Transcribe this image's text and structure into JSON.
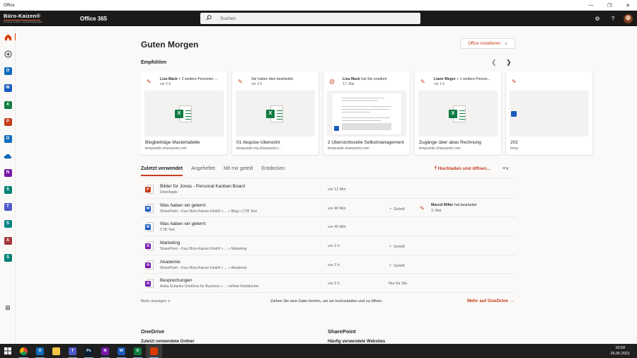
{
  "window": {
    "title": "Office"
  },
  "header": {
    "brand_name": "Büro-Kaizen®",
    "brand_tagline": "Ihr Partner für Büro- und Arbeitsorganisation",
    "app_name": "Office 365",
    "search_placeholder": "Suchen"
  },
  "main": {
    "greeting": "Guten Morgen",
    "install_label": "Office installieren",
    "recommended_title": "Empfohlen",
    "cards": [
      {
        "who": "Lisa Mack",
        "action": " + 2 weitere Personen ...",
        "when": "vor 2 h",
        "name": "Blogbeiträge Mastertabelle",
        "site": "tempuside.sharepoint.com",
        "icon": "pencil-icon",
        "thumb": "excel"
      },
      {
        "who": "",
        "action": "Sie haben dies bearbeitet.",
        "when": "vor 2 h",
        "name": "01 Akquise-Übersicht",
        "site": "tempuside-my.sharepoint.c...",
        "icon": "pencil-icon",
        "thumb": "excel"
      },
      {
        "who": "Lisa Mack",
        "action": " hat Sie erwähnt",
        "when": "17. Mai",
        "name": "2 Übersichtsseite Selbstmanagement",
        "site": "tempuside.sharepoint.com",
        "icon": "at-icon",
        "thumb": "doc"
      },
      {
        "who": "Liane Weger",
        "action": " + 1 weitere Person...",
        "when": "vor 1 h",
        "name": "Zugänge über abas Rechnung",
        "site": "tempuside.sharepoint.com",
        "icon": "pencil-icon",
        "thumb": "excel"
      },
      {
        "who": "",
        "action": "",
        "when": "",
        "name": "202",
        "site": "temp",
        "icon": "pencil-icon",
        "thumb": "word"
      }
    ],
    "tabs": [
      "Zuletzt verwendet",
      "Angeheftet",
      "Mit mir geteilt",
      "Entdecken"
    ],
    "upload_label": "Hochladen und öffnen...",
    "files": [
      {
        "name": "Bilder für Jonas - Personal Kanban Board",
        "location": "Downloads",
        "time": "vor 12 Min",
        "shared": "",
        "type": "ppt",
        "activity": null
      },
      {
        "name": "Was haben wir gelernt",
        "location": "SharePoint – Kurz Büro-Kaizen GmbH » ... » Blog » CTR Test",
        "time": "vor 40 Min",
        "shared": "Geteilt",
        "type": "word",
        "activity": {
          "who": "Marcel Miller",
          "what": " hat bearbeitet",
          "when": "3. Mai"
        }
      },
      {
        "name": "Was haben wir gelernt",
        "location": "CTR Test",
        "time": "vor 40 Min",
        "shared": "",
        "type": "word",
        "activity": null
      },
      {
        "name": "Marketing",
        "location": "SharePoint – Kurz Büro-Kaizen GmbH » ... » Marketing",
        "time": "vor 2 h",
        "shared": "Geteilt",
        "type": "onenote",
        "activity": null
      },
      {
        "name": "Akademie",
        "location": "SharePoint – Kurz Büro-Kaizen GmbH » ... » Akademie",
        "time": "vor 2 h",
        "shared": "Geteilt",
        "type": "onenote",
        "activity": null
      },
      {
        "name": "Besprechungen",
        "location": "Anika Schenks OneDrive for Business » ... »eNote Notizbücher",
        "time": "vor 2 h",
        "shared": "Nur für Sie",
        "type": "onenote",
        "activity": null
      }
    ],
    "more_label": "Mehr anzeigen",
    "drop_hint": "Ziehen Sie eine Datei hierhin, um sie hochzuladen und zu öffnen.",
    "onedrive_link": "Mehr auf OneDrive",
    "onedrive_title": "OneDrive",
    "onedrive_sub": "Zuletzt verwendete Ordner",
    "sharepoint_title": "SharePoint",
    "sharepoint_sub": "Häufig verwendete Websites"
  },
  "rail": [
    {
      "name": "home",
      "label": "",
      "color": "#d83b01"
    },
    {
      "name": "create",
      "label": "",
      "color": "#323130"
    },
    {
      "name": "outlook",
      "label": "O",
      "color": "#0f6cbd"
    },
    {
      "name": "word",
      "label": "W",
      "color": "#185abd"
    },
    {
      "name": "excel",
      "label": "X",
      "color": "#107c41"
    },
    {
      "name": "powerpoint",
      "label": "P",
      "color": "#c43e1c"
    },
    {
      "name": "outlook-2",
      "label": "O",
      "color": "#0f6cbd"
    },
    {
      "name": "onedrive",
      "label": "",
      "color": "#0364b8"
    },
    {
      "name": "onenote",
      "label": "N",
      "color": "#7719aa"
    },
    {
      "name": "sway",
      "label": "S",
      "color": "#008272"
    },
    {
      "name": "teams",
      "label": "T",
      "color": "#5059c9"
    },
    {
      "name": "sharepoint",
      "label": "S",
      "color": "#038387"
    },
    {
      "name": "access",
      "label": "A",
      "color": "#a4373a"
    },
    {
      "name": "sway-2",
      "label": "S",
      "color": "#008272"
    }
  ],
  "taskbar": {
    "apps": [
      {
        "name": "chrome",
        "label": "",
        "color": "#e8a317"
      },
      {
        "name": "outlook",
        "label": "O",
        "color": "#0f6cbd"
      },
      {
        "name": "explorer",
        "label": "",
        "color": "#f4c542"
      },
      {
        "name": "teams",
        "label": "T",
        "color": "#5059c9"
      },
      {
        "name": "photoshop",
        "label": "Ps",
        "color": "#001e36"
      },
      {
        "name": "onenote",
        "label": "N",
        "color": "#7719aa"
      },
      {
        "name": "word",
        "label": "W",
        "color": "#185abd"
      },
      {
        "name": "excel",
        "label": "X",
        "color": "#107c41"
      },
      {
        "name": "office",
        "label": "",
        "color": "#d83b01"
      }
    ],
    "time": "10:59",
    "date": "26.05.2021"
  },
  "colors": {
    "accent": "#c43e1c",
    "header_bg": "#1b1a19",
    "page_bg": "#faf9f8"
  }
}
